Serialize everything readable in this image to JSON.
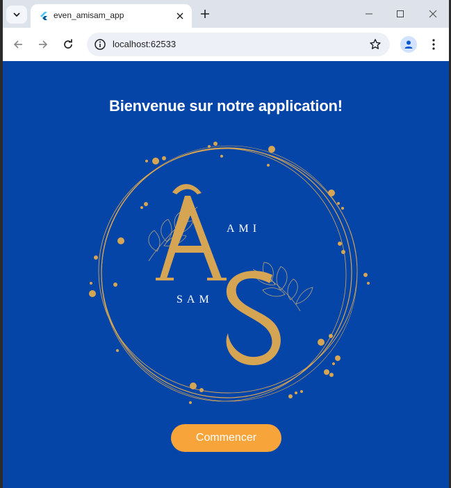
{
  "browser": {
    "tab_title": "even_amisam_app",
    "url": "localhost:62533"
  },
  "page": {
    "welcome_title": "Bienvenue sur notre application!",
    "start_button_label": "Commencer",
    "logo": {
      "monogram": "AS",
      "text_top": "AMI",
      "text_bottom": "SAM"
    }
  },
  "colors": {
    "page_background": "#0645a8",
    "logo_gold": "#d6a553",
    "button_orange": "#f7a53a"
  },
  "icons": [
    "chevron-down-icon",
    "flutter-icon",
    "close-icon",
    "plus-icon",
    "minimize-icon",
    "maximize-icon",
    "back-icon",
    "forward-icon",
    "reload-icon",
    "info-icon",
    "star-icon",
    "profile-icon",
    "kebab-menu-icon"
  ]
}
